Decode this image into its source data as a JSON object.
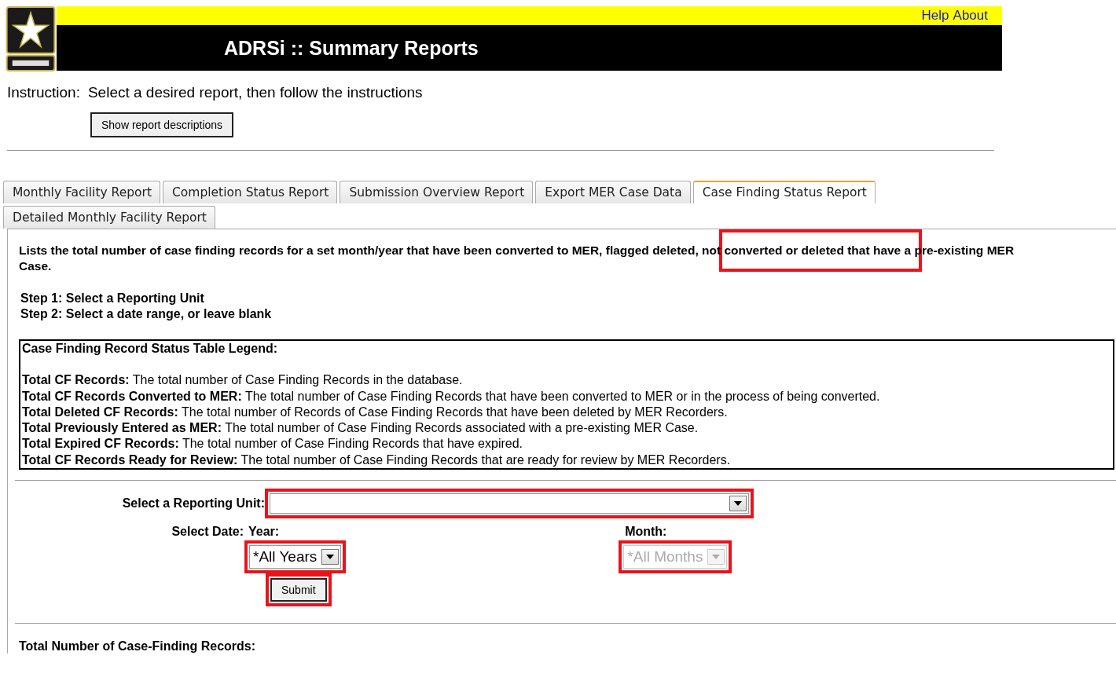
{
  "header": {
    "title": "ADRSi :: Summary Reports",
    "links": [
      "Help",
      "About"
    ]
  },
  "instruction": {
    "label": "Instruction:",
    "text": "Select a desired report, then follow the instructions"
  },
  "show_descriptions_button": "Show report descriptions",
  "tabs": [
    {
      "label": "Monthly Facility Report",
      "selected": false
    },
    {
      "label": "Completion Status Report",
      "selected": false
    },
    {
      "label": "Submission Overview Report",
      "selected": false
    },
    {
      "label": "Export MER Case Data",
      "selected": false
    },
    {
      "label": "Case Finding Status Report",
      "selected": true
    },
    {
      "label": "Detailed Monthly Facility Report",
      "selected": false
    }
  ],
  "description": "Lists the total number of case finding records for a set month/year that have been converted to MER, flagged deleted, not converted or deleted that have a pre-existing MER Case.",
  "description_highlight": true,
  "steps": [
    "Step 1: Select a Reporting Unit",
    "Step 2: Select a date range, or leave blank"
  ],
  "legend": {
    "title": "Case Finding Record Status Table Legend:",
    "items": [
      {
        "term": "Total CF Records:",
        "text": "The total number of Case Finding Records in the database."
      },
      {
        "term": "Total CF Records Converted to MER:",
        "text": "The total number of Case Finding Records that have been converted to MER or in the process of being converted."
      },
      {
        "term": "Total Deleted CF Records:",
        "text": "The total number of Records of Case Finding Records that have been deleted by MER Recorders."
      },
      {
        "term": "Total Previously Entered as MER:",
        "text": "The total number of Case Finding Records associated with a pre-existing MER Case."
      },
      {
        "term": "Total Expired CF Records:",
        "text": "The total number of Case Finding Records that have expired."
      },
      {
        "term": "Total CF Records Ready for Review:",
        "text": "The total number of Case Finding Records that are ready for review by MER Recorders."
      }
    ]
  },
  "form": {
    "reporting_unit": {
      "label": "Select a Reporting Unit:",
      "highlighted": true
    },
    "date_label": "Select Date:",
    "year": {
      "label": "Year:",
      "value": "*All Years",
      "disabled": false,
      "highlighted": true
    },
    "month": {
      "label": "Month:",
      "value": "*All Months",
      "disabled": true,
      "highlighted": true
    },
    "submit": {
      "label": "Submit",
      "highlighted": true
    }
  },
  "results_title": "Total Number of Case-Finding Records:"
}
